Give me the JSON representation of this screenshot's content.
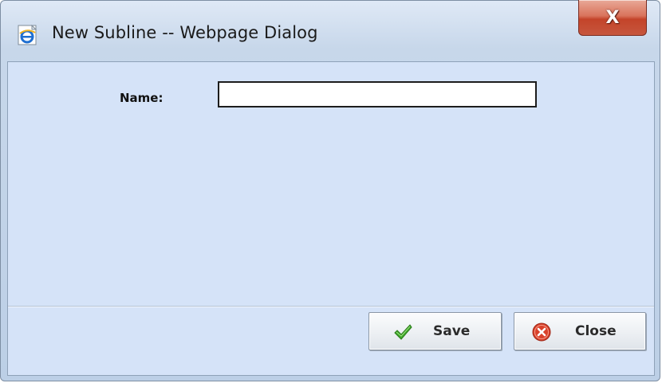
{
  "window": {
    "title": "New Subline -- Webpage Dialog",
    "title_icon": "internet-explorer-icon",
    "close_glyph": "X"
  },
  "form": {
    "name_label": "Name:",
    "name_value": "",
    "name_placeholder": ""
  },
  "footer": {
    "save_label": "Save",
    "save_icon": "checkmark-icon",
    "close_label": "Close",
    "close_icon": "error-circle-icon"
  },
  "colors": {
    "client_background": "#d5e3f8",
    "close_button_red": "#c4442a",
    "checkmark_green": "#3fa82a"
  }
}
